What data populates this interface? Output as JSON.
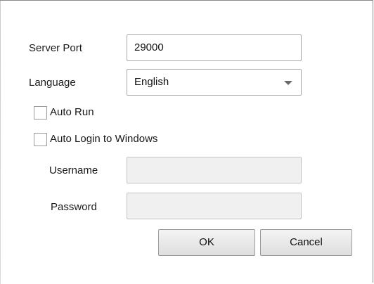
{
  "settings": {
    "server_port_label": "Server Port",
    "server_port_value": "29000",
    "language_label": "Language",
    "language_value": "English",
    "auto_run_label": "Auto Run",
    "auto_run_checked": false,
    "auto_login_label": "Auto Login to Windows",
    "auto_login_checked": false,
    "username_label": "Username",
    "username_value": "",
    "password_label": "Password",
    "password_value": ""
  },
  "buttons": {
    "ok_label": "OK",
    "cancel_label": "Cancel"
  },
  "icons": {
    "language_dropdown": "chevron-down-icon"
  }
}
